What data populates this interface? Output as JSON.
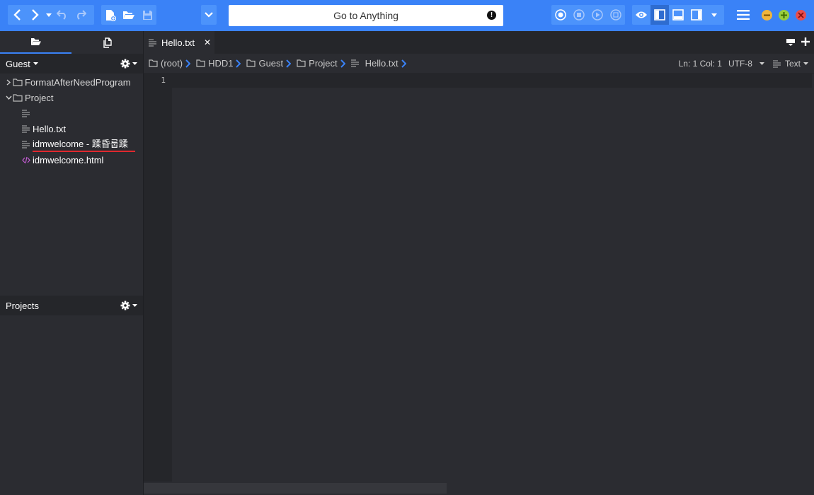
{
  "toolbar": {
    "goto_label": "Go to Anything",
    "goto_alert": "!"
  },
  "sidebar": {
    "user_label": "Guest",
    "tree": [
      {
        "label": "FormatAfterNeedProgram",
        "type": "folder",
        "expanded": false
      },
      {
        "label": "Project",
        "type": "folder",
        "expanded": true
      },
      {
        "label": "",
        "type": "text-file"
      },
      {
        "label": "Hello.txt",
        "type": "text-file"
      },
      {
        "label": "idmwelcome - 蹂昏룹蹂",
        "type": "text-file"
      },
      {
        "label": "idmwelcome.html",
        "type": "html-file"
      }
    ],
    "projects_label": "Projects"
  },
  "editor": {
    "tab_label": "Hello.txt",
    "tab_close": "✕",
    "breadcrumb": [
      "(root)",
      "HDD1",
      "Guest",
      "Project",
      "Hello.txt"
    ],
    "status": {
      "position": "Ln: 1 Col: 1",
      "encoding": "UTF-8",
      "language": "Text"
    },
    "line_number": "1"
  },
  "colors": {
    "accent": "#3a82f7",
    "background": "#2b2c31",
    "html_icon": "#c25bd1",
    "spell_underline": "#e0282e",
    "minimize": "#f0b53d",
    "maximize": "#9acd3c",
    "close": "#e84e4e"
  }
}
